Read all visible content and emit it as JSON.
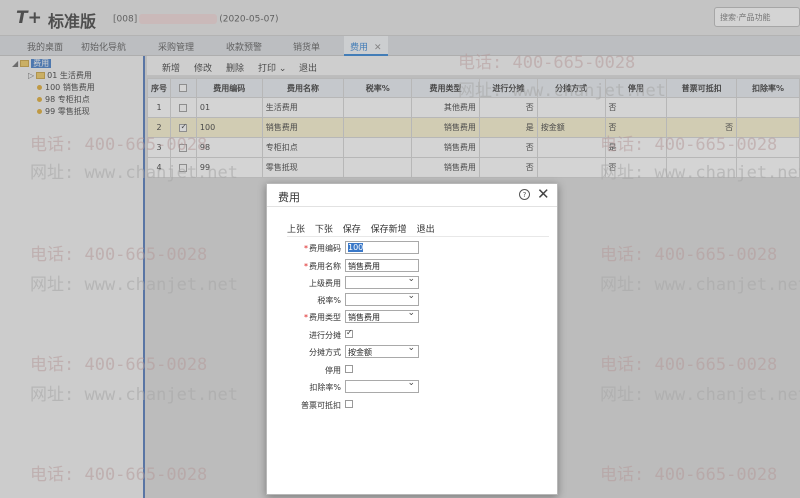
{
  "header": {
    "logo_mark": "T+",
    "app_name": "标准版",
    "account_prefix": "[008]",
    "account_date": "(2020-05-07)",
    "search_placeholder": "搜索·产品功能"
  },
  "tabs": [
    {
      "label": "我的桌面"
    },
    {
      "label": "初始化导航"
    },
    {
      "label": "采购管理"
    },
    {
      "label": "收款预警"
    },
    {
      "label": "销货单"
    },
    {
      "label": "费用",
      "active": true
    }
  ],
  "tree": {
    "root": "费用",
    "items": [
      "01 生活费用",
      "100 销售费用",
      "98 专柜扣点",
      "99 零售抵现"
    ]
  },
  "toolbar": [
    "新增",
    "修改",
    "删除",
    "打印",
    "退出"
  ],
  "grid": {
    "columns": [
      "序号",
      "",
      "费用编码",
      "费用名称",
      "税率%",
      "费用类型",
      "进行分摊",
      "分摊方式",
      "停用",
      "普票可抵扣",
      "扣除率%"
    ],
    "rows": [
      {
        "no": "1",
        "checked": false,
        "code": "01",
        "name": "生活费用",
        "tax": "",
        "type": "其他费用",
        "alloc": "否",
        "method": "",
        "disabled": "否",
        "deduct": "",
        "rate": ""
      },
      {
        "no": "2",
        "checked": true,
        "code": "100",
        "name": "销售费用",
        "tax": "",
        "type": "销售费用",
        "alloc": "是",
        "method": "按金额",
        "disabled": "否",
        "deduct": "否",
        "rate": ""
      },
      {
        "no": "3",
        "checked": false,
        "code": "98",
        "name": "专柜扣点",
        "tax": "",
        "type": "销售费用",
        "alloc": "否",
        "method": "",
        "disabled": "是",
        "deduct": "",
        "rate": ""
      },
      {
        "no": "4",
        "checked": false,
        "code": "99",
        "name": "零售抵现",
        "tax": "",
        "type": "销售费用",
        "alloc": "否",
        "method": "",
        "disabled": "否",
        "deduct": "",
        "rate": ""
      }
    ]
  },
  "modal": {
    "title": "费用",
    "help": "?",
    "close": "✕",
    "toolbar": [
      "上张",
      "下张",
      "保存",
      "保存新增",
      "退出"
    ],
    "fields": {
      "code_label": "费用编码",
      "code_value": "100",
      "name_label": "费用名称",
      "name_value": "销售费用",
      "parent_label": "上级费用",
      "parent_value": "",
      "tax_label": "税率%",
      "tax_value": "",
      "type_label": "费用类型",
      "type_value": "销售费用",
      "alloc_label": "进行分摊",
      "alloc_checked": true,
      "method_label": "分摊方式",
      "method_value": "按金额",
      "disabled_label": "停用",
      "disabled_checked": false,
      "rate_label": "扣除率%",
      "rate_value": "",
      "deduct_label": "普票可抵扣",
      "deduct_checked": false
    }
  },
  "watermark": {
    "phone": "电话: 400-665-0028",
    "site": "网址: www.chanjet.net"
  }
}
